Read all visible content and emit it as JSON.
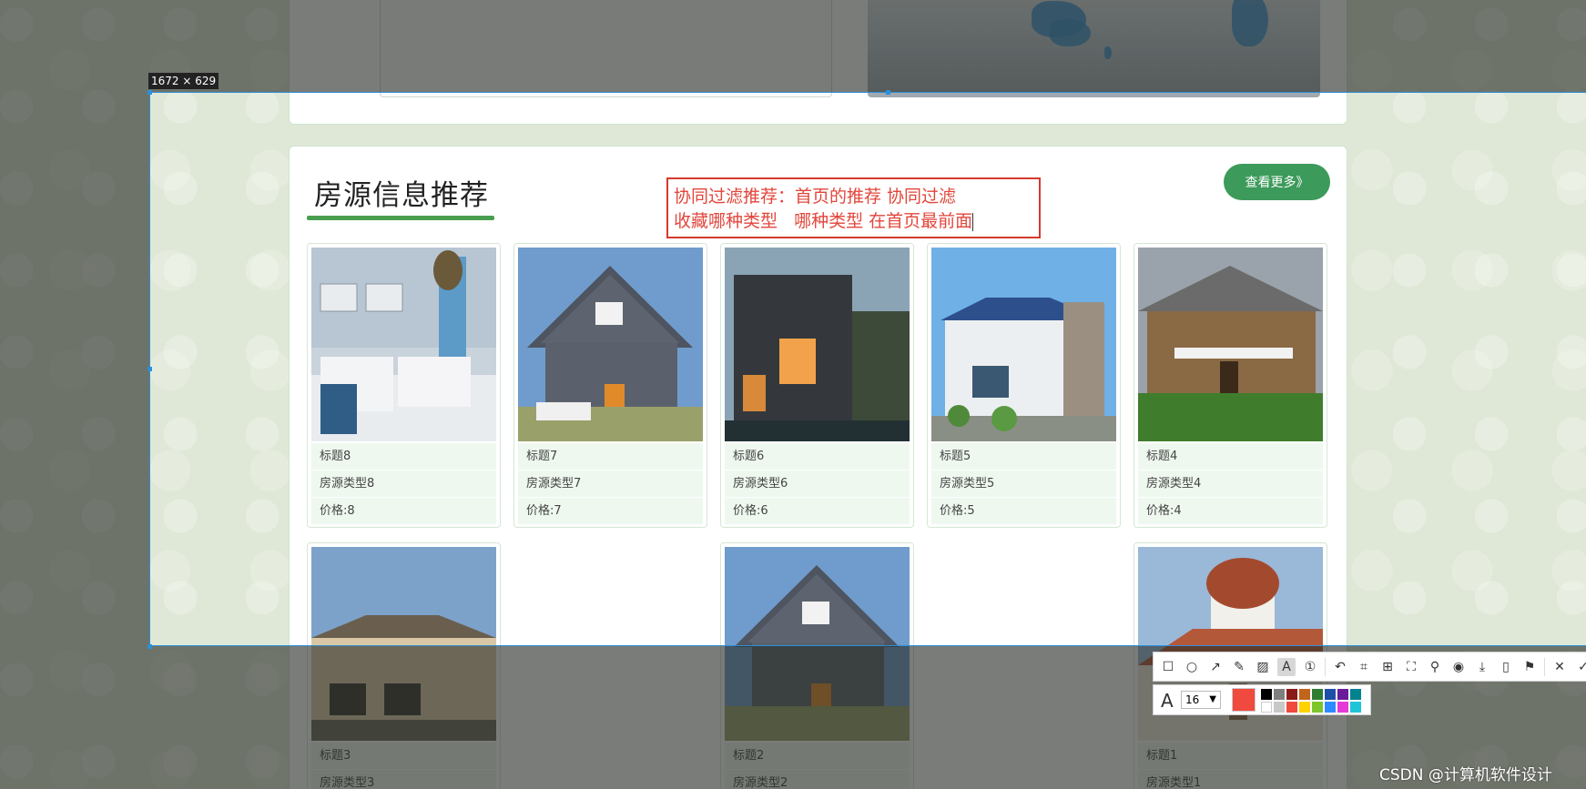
{
  "section": {
    "title": "房源信息推荐",
    "more_button": "查看更多》"
  },
  "annotation": {
    "line1": "协同过滤推荐：首页的推荐 协同过滤",
    "line2": "收藏哪种类型   哪种类型 在首页最前面"
  },
  "capture": {
    "size_label": "1672 × 629"
  },
  "listings": [
    {
      "title": "标题8",
      "type": "房源类型8",
      "price": "价格:8"
    },
    {
      "title": "标题7",
      "type": "房源类型7",
      "price": "价格:7"
    },
    {
      "title": "标题6",
      "type": "房源类型6",
      "price": "价格:6"
    },
    {
      "title": "标题5",
      "type": "房源类型5",
      "price": "价格:5"
    },
    {
      "title": "标题4",
      "type": "房源类型4",
      "price": "价格:4"
    },
    {
      "title": "标题3",
      "type": "房源类型3"
    },
    {
      "title": "标题2",
      "type": "房源类型2"
    },
    {
      "title": "标题1",
      "type": "房源类型1"
    }
  ],
  "toolbar": {
    "font_size": "16",
    "active_color": "#f0493e",
    "icons": [
      "rectangle-icon",
      "ellipse-icon",
      "arrow-icon",
      "pencil-icon",
      "mosaic-icon",
      "text-icon",
      "number-icon",
      "undo-icon",
      "ocr-icon",
      "translate-icon",
      "long-capture-icon",
      "pin-icon",
      "record-icon",
      "save-icon",
      "phone-icon",
      "bookmark-icon",
      "close-icon",
      "confirm-icon"
    ]
  },
  "watermark": "CSDN @计算机软件设计"
}
